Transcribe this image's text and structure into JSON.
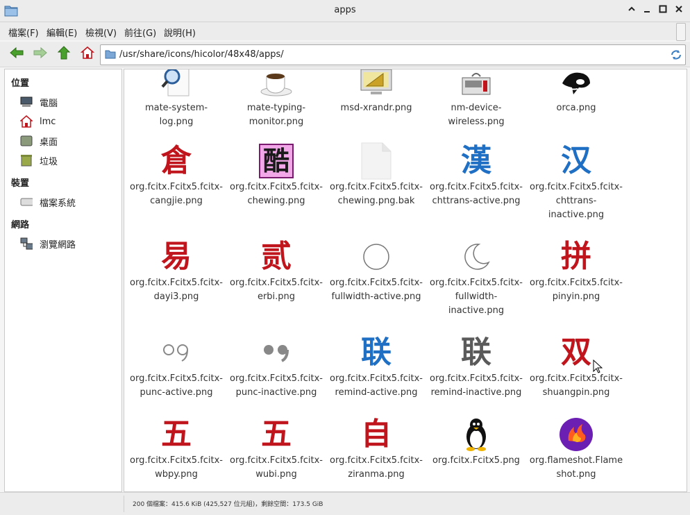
{
  "window": {
    "title": "apps"
  },
  "menubar": {
    "items": [
      "檔案(F)",
      "編輯(E)",
      "檢視(V)",
      "前往(G)",
      "說明(H)"
    ]
  },
  "toolbar": {
    "path": "/usr/share/icons/hicolor/48x48/apps/"
  },
  "sidebar": {
    "sections": [
      {
        "header": "位置",
        "items": [
          {
            "label": "電腦",
            "icon": "computer-icon"
          },
          {
            "label": "lmc",
            "icon": "home-icon"
          },
          {
            "label": "桌面",
            "icon": "desktop-icon"
          },
          {
            "label": "垃圾",
            "icon": "trash-icon"
          }
        ]
      },
      {
        "header": "裝置",
        "items": [
          {
            "label": "檔案系統",
            "icon": "drive-icon"
          }
        ]
      },
      {
        "header": "網路",
        "items": [
          {
            "label": "瀏覽網路",
            "icon": "network-icon"
          }
        ]
      }
    ]
  },
  "files": [
    {
      "name": "mate-system-log.png",
      "icon": "magnifier-log-icon",
      "glyph": "",
      "color": "#555555"
    },
    {
      "name": "mate-typing-monitor.png",
      "icon": "coffee-cup-icon",
      "glyph": "",
      "color": "#555555"
    },
    {
      "name": "msd-xrandr.png",
      "icon": "display-settings-icon",
      "glyph": "",
      "color": "#555555"
    },
    {
      "name": "nm-device-wireless.png",
      "icon": "wireless-device-icon",
      "glyph": "",
      "color": "#555555"
    },
    {
      "name": "orca.png",
      "icon": "orca-whale-icon",
      "glyph": "",
      "color": "#111111"
    },
    {
      "name": "org.fcitx.Fcitx5.fcitx-cangjie.png",
      "icon": "cangjie-icon",
      "glyph": "倉",
      "color": "#c0151c"
    },
    {
      "name": "org.fcitx.Fcitx5.fcitx-chewing.png",
      "icon": "chewing-icon",
      "glyph": "酷",
      "color": "#1a1a1a"
    },
    {
      "name": "org.fcitx.Fcitx5.fcitx-chewing.png.bak",
      "icon": "blank-file-icon",
      "glyph": "",
      "color": "#cccccc"
    },
    {
      "name": "org.fcitx.Fcitx5.fcitx-chttrans-active.png",
      "icon": "chttrans-active-icon",
      "glyph": "漢",
      "color": "#1f6fc4"
    },
    {
      "name": "org.fcitx.Fcitx5.fcitx-chttrans-inactive.png",
      "icon": "chttrans-inactive-icon",
      "glyph": "汉",
      "color": "#1f6fc4"
    },
    {
      "name": "org.fcitx.Fcitx5.fcitx-dayi3.png",
      "icon": "dayi-icon",
      "glyph": "易",
      "color": "#c0151c"
    },
    {
      "name": "org.fcitx.Fcitx5.fcitx-erbi.png",
      "icon": "erbi-icon",
      "glyph": "贰",
      "color": "#c0151c"
    },
    {
      "name": "org.fcitx.Fcitx5.fcitx-fullwidth-active.png",
      "icon": "circle-icon",
      "glyph": "",
      "color": "#666666"
    },
    {
      "name": "org.fcitx.Fcitx5.fcitx-fullwidth-inactive.png",
      "icon": "moon-icon",
      "glyph": "",
      "color": "#666666"
    },
    {
      "name": "org.fcitx.Fcitx5.fcitx-pinyin.png",
      "icon": "pinyin-icon",
      "glyph": "拼",
      "color": "#c0151c"
    },
    {
      "name": "org.fcitx.Fcitx5.fcitx-punc-active.png",
      "icon": "quote-outline-icon",
      "glyph": "",
      "color": "#888888"
    },
    {
      "name": "org.fcitx.Fcitx5.fcitx-punc-inactive.png",
      "icon": "quote-filled-icon",
      "glyph": "",
      "color": "#888888"
    },
    {
      "name": "org.fcitx.Fcitx5.fcitx-remind-active.png",
      "icon": "remind-active-icon",
      "glyph": "联",
      "color": "#1f6fc4"
    },
    {
      "name": "org.fcitx.Fcitx5.fcitx-remind-inactive.png",
      "icon": "remind-inactive-icon",
      "glyph": "联",
      "color": "#5a5a5a"
    },
    {
      "name": "org.fcitx.Fcitx5.fcitx-shuangpin.png",
      "icon": "shuangpin-icon",
      "glyph": "双",
      "color": "#c0151c"
    },
    {
      "name": "org.fcitx.Fcitx5.fcitx-wbpy.png",
      "icon": "wbpy-icon",
      "glyph": "五",
      "color": "#c0151c"
    },
    {
      "name": "org.fcitx.Fcitx5.fcitx-wubi.png",
      "icon": "wubi-icon",
      "glyph": "五",
      "color": "#c0151c"
    },
    {
      "name": "org.fcitx.Fcitx5.fcitx-ziranma.png",
      "icon": "ziranma-icon",
      "glyph": "自",
      "color": "#c0151c"
    },
    {
      "name": "org.fcitx.Fcitx5.png",
      "icon": "penguin-icon",
      "glyph": "",
      "color": "#111111"
    },
    {
      "name": "org.flameshot.Flameshot.png",
      "icon": "flameshot-icon",
      "glyph": "",
      "color": "#6b1fb3"
    }
  ],
  "status": {
    "text": "200 個檔案：415.6 KiB (425,527 位元組)，剩餘空間：173.5 GiB"
  }
}
